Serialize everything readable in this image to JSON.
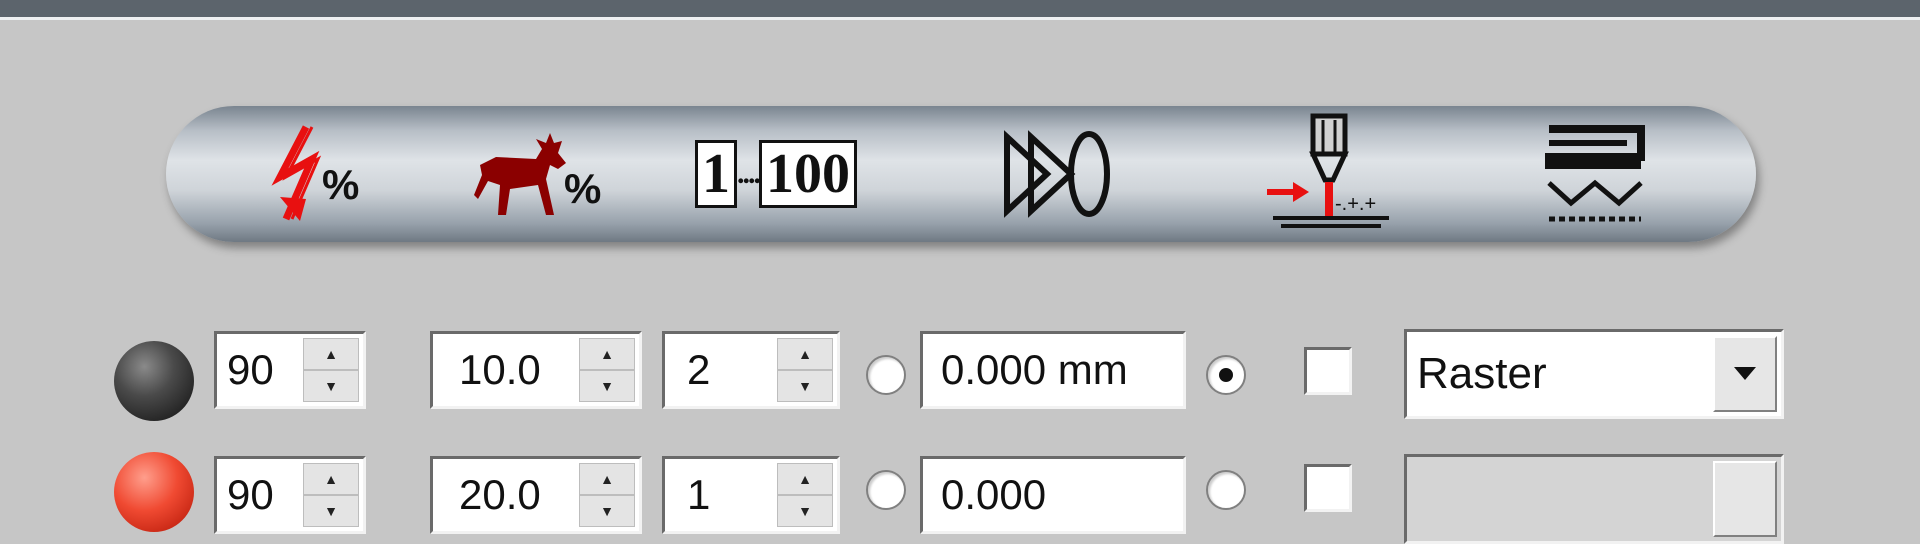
{
  "toolbar": {
    "tools": [
      {
        "name": "power-percent",
        "label": "%"
      },
      {
        "name": "speed-percent",
        "label": "%"
      },
      {
        "name": "frequency-range",
        "label_min": "1",
        "label_dots": "....",
        "label_max": "100"
      },
      {
        "name": "focus-lens"
      },
      {
        "name": "air-assist"
      },
      {
        "name": "raster-mode"
      }
    ]
  },
  "rows": [
    {
      "led_color": "#3a3a3a",
      "power": "90",
      "speed": "10.0",
      "passes": "2",
      "offset_radio_selected": false,
      "z_offset": "0.000 mm",
      "z_radio_selected": true,
      "checked": false,
      "mode": "Raster"
    },
    {
      "led_color": "#f04a32",
      "power": "90",
      "speed": "20.0",
      "passes": "1",
      "offset_radio_selected": false,
      "z_offset": "0.000",
      "z_radio_selected": false,
      "checked": false,
      "mode": ""
    }
  ],
  "colors": {
    "background": "#c6c6c6",
    "top_bar": "#5c646c",
    "laser_red": "#e81010",
    "deer_red": "#8b0000"
  }
}
